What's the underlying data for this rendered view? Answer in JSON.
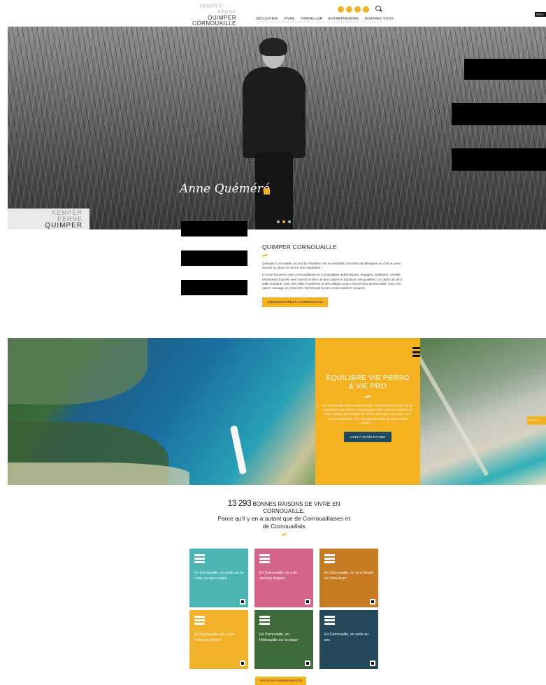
{
  "header": {
    "logo": {
      "line1": "KEMPER",
      "line2": "KERNE",
      "line3": "QUIMPER",
      "line4": "CORNOUAILLE"
    },
    "social_icons": [
      "facebook-icon",
      "twitter-icon",
      "instagram-icon",
      "youtube-icon"
    ],
    "nav": [
      "DÉCOUVRIR",
      "VIVRE",
      "TRAVAILLER",
      "ENTREPRENDRE",
      "INSPIREZ-VOUS"
    ],
    "tag": "BREZ"
  },
  "hero": {
    "signature": "Anne Quéméré",
    "logo": {
      "line1": "KEMPER",
      "line2": "KERNE",
      "line3": "QUIMPER"
    }
  },
  "intro": {
    "title": "QUIMPER CORNOUAILLE",
    "paragraph1": "Quimper Cornouaille, au sud du Finistère, est un véritable concentré de Bretagne où chacun peut trouver sa place et nourrir son inspiration !",
    "paragraph2": "Ici vous trouverez des Cornouaillaises et Cornouaillais authentiques, engagés, solidaires, créatifs, résolument tournés vers l'avenir et fiers de leur culture et traditions renouvelées. Un cadre de vie à taille humaine, avec des villes moyennes et des villages ayant chacun leur personnalité. Avec une nature sauvage et préservée, bercée par la mer et des lumières uniques.",
    "button": "(RE)DÉCOUVREZ LA CORNOUAILLE"
  },
  "feature": {
    "title_line1": "ÉQUILIBRE VIE PERSO",
    "title_line2": "& VIE PRO",
    "text": "En Cornouaille vivez à votre rythme. Votre job est à moins de 15 minutes de vos clients et fournisseurs mais aussi à 5 minutes de votre maison, de la plage, de l'école, de la gare TGV, d'un ciné ou d'un spectacle, de votre club de sport, de votre restau préféré...",
    "button": "VIVEZ À VOTRE RYTHME",
    "side_tab": "BOITE À"
  },
  "reasons": {
    "count": "13 293",
    "line1_rest": " BONNES RAISONS DE VIVRE EN CORNOUAILLE.",
    "line2": "Parce qu'il y en a autant que de Cornouaillaises et de Cornouaillais",
    "cards": [
      {
        "text": "En Cornouaille, on roule sur la route du vent solaire",
        "color": "#4ab5b3"
      },
      {
        "text": "En Cornouaille, on a de sacrées trognes",
        "color": "#d4648a"
      },
      {
        "text": "En Cornouaille, on va à l'école de Pont-Aven",
        "color": "#c67a22"
      },
      {
        "text": "En Cornouaille, on a une carte aux trésors",
        "color": "#f2b12a"
      },
      {
        "text": "En Cornouaille, on télétravaille sur la plage !",
        "color": "#3e6b3c"
      },
      {
        "text": "En Cornouaille, on surfe au sec",
        "color": "#24495a"
      }
    ],
    "button": "TOUTES LES BONNES RAISONS"
  },
  "colors": {
    "accent": "#f4b120",
    "dark_button": "#1e4a5c"
  }
}
